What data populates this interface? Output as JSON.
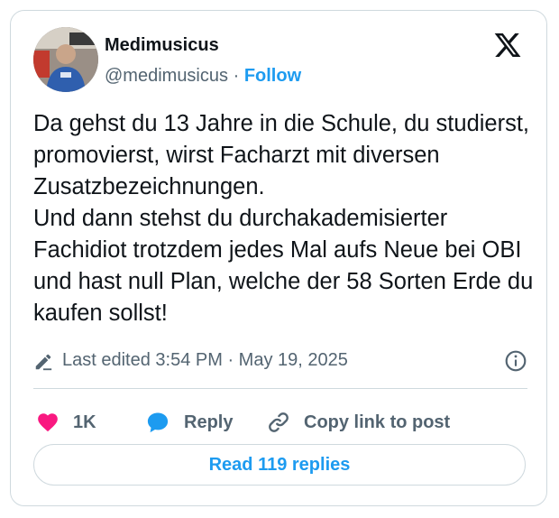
{
  "author": {
    "display_name": "Medimusicus",
    "handle": "@medimusicus",
    "separator": "·",
    "follow_label": "Follow"
  },
  "tweet": {
    "text": "Da gehst du 13 Jahre in die Schule, du studierst, promovierst, wirst Facharzt mit diversen Zusatzbezeichnungen.\nUnd dann stehst du durchakademisierter Fachidiot trotzdem jedes Mal aufs Neue bei OBI und hast null Plan, welche der 58 Sorten Erde du kaufen sollst!"
  },
  "meta": {
    "edited_text": "Last edited 3:54 PM · May 19, 2025",
    "icons": [
      "pencil-icon",
      "info-icon"
    ]
  },
  "actions": {
    "like_count": "1K",
    "reply_label": "Reply",
    "copy_label": "Copy link to post"
  },
  "read_replies_label": "Read 119 replies",
  "colors": {
    "accent": "#1d9bf0",
    "like": "#f91880",
    "text": "#0f1419",
    "secondary": "#536471",
    "border": "#cfd9de"
  },
  "icons": [
    "x-logo-icon",
    "heart-icon",
    "reply-icon",
    "link-icon"
  ]
}
